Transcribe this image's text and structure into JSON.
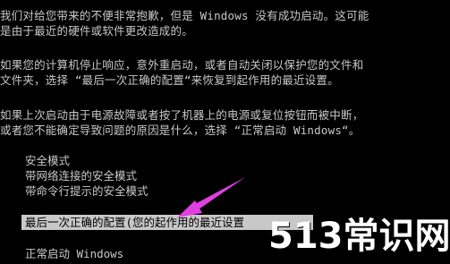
{
  "screen": {
    "paragraphs": [
      "我们对给您带来的不便非常抱歉，但是 Windows 没有成功启动。这可能",
      "是由于最近的硬件或软件更改造成的。",
      "如果您的计算机停止响应，意外重启动，或者自动关闭以保护您的文件和",
      "文件夹，选择 “最后一次正确的配置“来恢复到起作用的最近设置。",
      "如果上次启动由于电源故障或者按了机器上的电源或复位按钮而被中断，",
      "或者您不能确定导致问题的原因是什么，选择 “正常启动 Windows“。"
    ],
    "menu": [
      "安全模式",
      "带网络连接的安全模式",
      "带命令行提示的安全模式"
    ],
    "selected_option": "最后一次正确的配置(您的起作用的最近设置",
    "bottom_option": "正常启动 Windows",
    "watermark": "513常识网"
  },
  "colors": {
    "background": "#000000",
    "text": "#c8c8c8",
    "highlight": "#c8c8c8",
    "arrow": "#e040e0"
  }
}
